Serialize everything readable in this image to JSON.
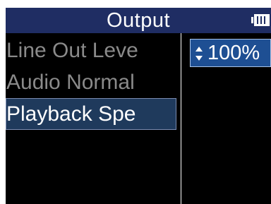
{
  "header": {
    "title": "Output",
    "battery_icon": "battery-icon"
  },
  "menu": {
    "items": [
      {
        "label": "Line Out Leve"
      },
      {
        "label": "Audio Normal"
      },
      {
        "label": "Playback Spe"
      }
    ],
    "selected_index": 2
  },
  "value_panel": {
    "value": "100%",
    "arrows_icon": "up-down-arrows-icon"
  },
  "colors": {
    "header_bg": "#1f2d63",
    "screen_bg": "#000000",
    "selected_bg": "#1f3a5c",
    "value_bg": "#1e4f93",
    "inactive_text": "#8a8a8a",
    "active_text": "#ffffff"
  }
}
